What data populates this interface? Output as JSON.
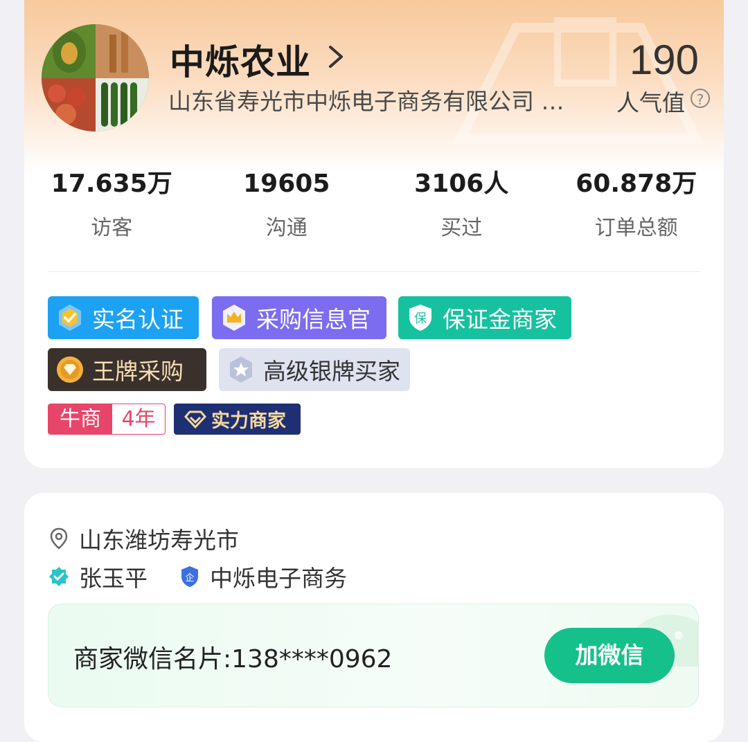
{
  "shop": {
    "name": "中烁农业",
    "company": "山东省寿光市中烁电子商务有限公司 …",
    "popularity_value": "190",
    "popularity_label": "人气值"
  },
  "stats": [
    {
      "value": "17.635万",
      "label": "访客"
    },
    {
      "value": "19605",
      "label": "沟通"
    },
    {
      "value": "3106人",
      "label": "买过"
    },
    {
      "value": "60.878万",
      "label": "订单总额"
    }
  ],
  "badges": {
    "real_name": "实名认证",
    "purchase_officer": "采购信息官",
    "deposit_merchant": "保证金商家",
    "ace_purchase": "王牌采购",
    "silver_buyer": "高级银牌买家",
    "niu_label": "牛商",
    "niu_years": "4年",
    "strength_merchant": "实力商家"
  },
  "contact": {
    "location": "山东潍坊寿光市",
    "person": "张玉平",
    "company_short": "中烁电子商务",
    "wechat_label": "商家微信名片:138****0962",
    "wechat_button": "加微信"
  },
  "colors": {
    "accent_green": "#16c08a",
    "badge_blue": "#1da1f2",
    "badge_purple": "#7b6cf0",
    "badge_teal": "#16c1a0",
    "niu_red": "#e8456a",
    "strength_navy": "#1f2f73"
  }
}
